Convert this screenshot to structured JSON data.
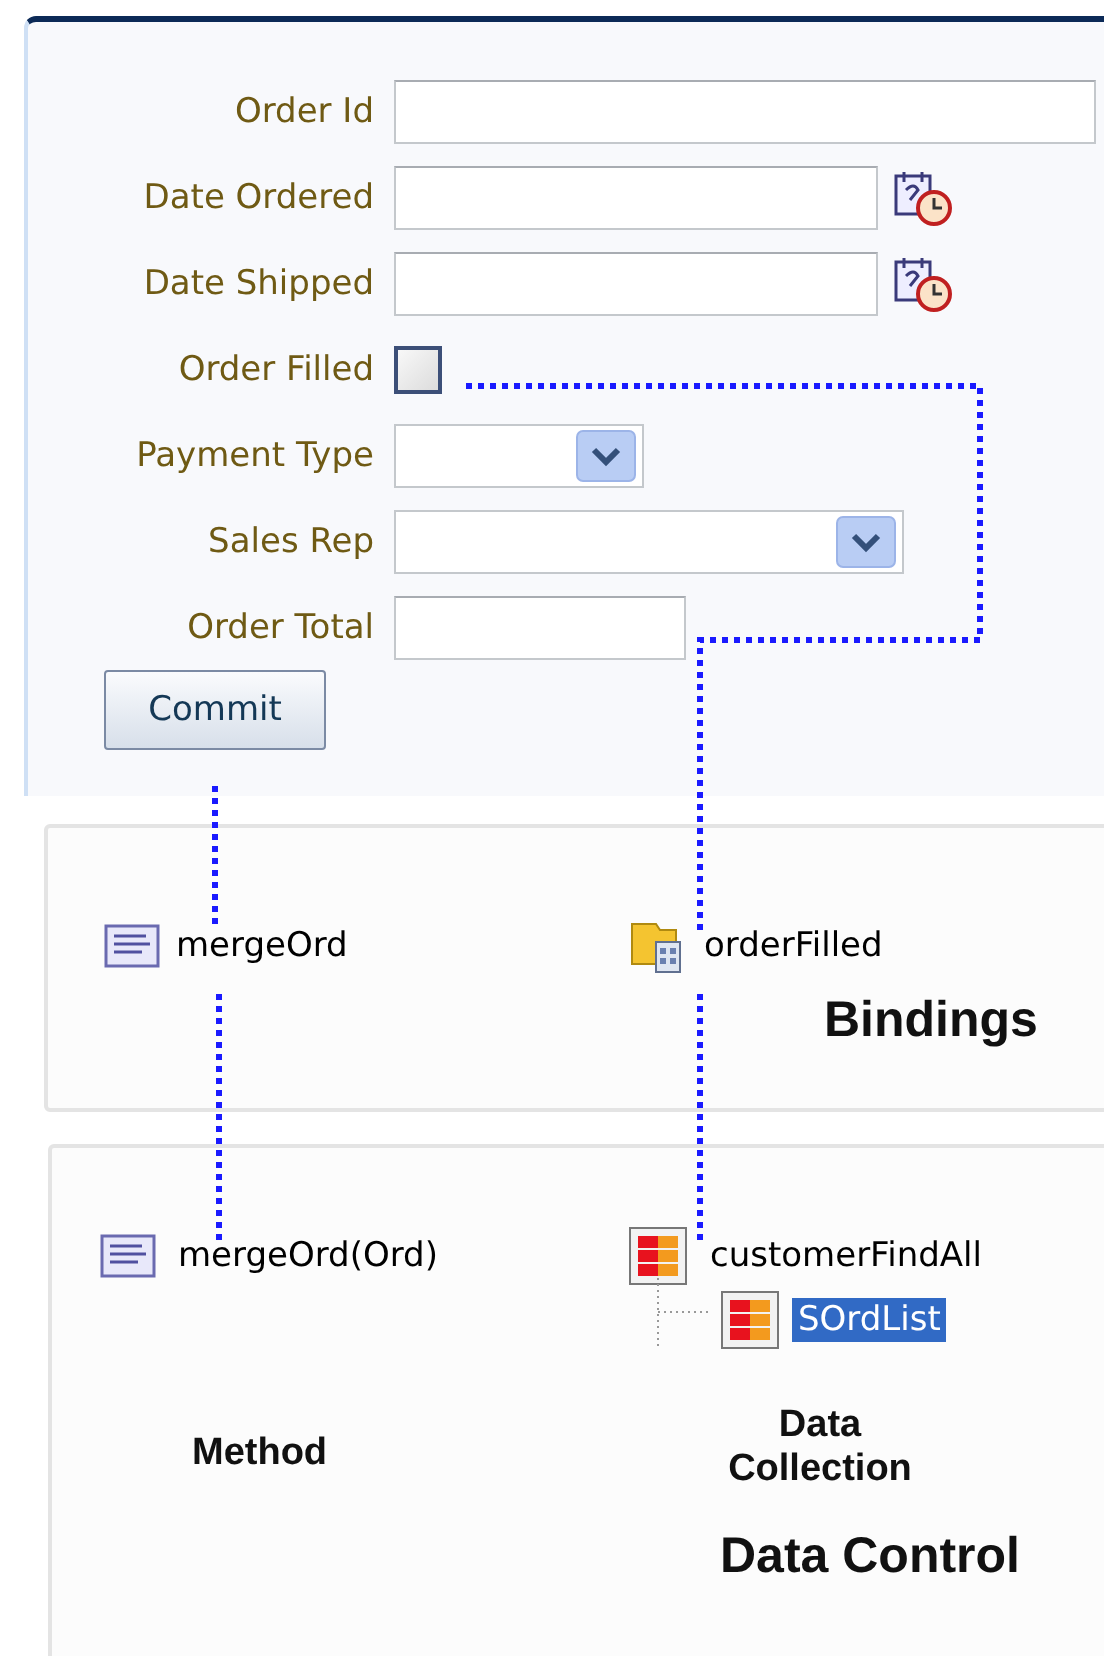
{
  "form": {
    "fields": [
      {
        "kind": "text",
        "label": "Order Id"
      },
      {
        "kind": "date",
        "label": "Date Ordered"
      },
      {
        "kind": "date",
        "label": "Date Shipped"
      },
      {
        "kind": "checkbox",
        "label": "Order Filled",
        "checked": false
      },
      {
        "kind": "select",
        "label": "Payment Type"
      },
      {
        "kind": "select",
        "label": "Sales Rep"
      },
      {
        "kind": "text",
        "label": "Order Total"
      }
    ],
    "button": "Commit"
  },
  "bindings": {
    "title": "Bindings",
    "items": [
      {
        "kind": "method",
        "label": "mergeOrd"
      },
      {
        "kind": "attribute",
        "label": "orderFilled"
      }
    ]
  },
  "data_control": {
    "title": "Data Control",
    "columns": [
      {
        "kind": "method",
        "caption": "Method",
        "items": [
          {
            "label": "mergeOrd(Ord)",
            "selected": false
          }
        ]
      },
      {
        "kind": "collection",
        "caption": "Data Collection",
        "items": [
          {
            "label": "customerFindAll",
            "selected": false,
            "children": [
              {
                "label": "SOrdList",
                "selected": true
              }
            ]
          }
        ]
      }
    ]
  }
}
